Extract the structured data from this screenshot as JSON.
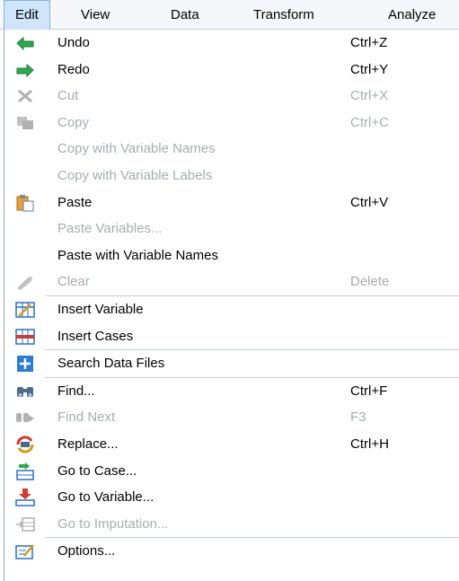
{
  "menubar": {
    "items": [
      {
        "label": "Edit",
        "active": true
      },
      {
        "label": "View",
        "active": false
      },
      {
        "label": "Data",
        "active": false
      },
      {
        "label": "Transform",
        "active": false
      },
      {
        "label": "Analyze",
        "active": false
      }
    ]
  },
  "menu": {
    "items": [
      {
        "label": "Undo",
        "shortcut": "Ctrl+Z",
        "icon": "undo-icon",
        "enabled": true
      },
      {
        "label": "Redo",
        "shortcut": "Ctrl+Y",
        "icon": "redo-icon",
        "enabled": true
      },
      {
        "label": "Cut",
        "shortcut": "Ctrl+X",
        "icon": "cut-icon",
        "enabled": false
      },
      {
        "label": "Copy",
        "shortcut": "Ctrl+C",
        "icon": "copy-icon",
        "enabled": false
      },
      {
        "label": "Copy with Variable Names",
        "shortcut": "",
        "icon": "",
        "enabled": false
      },
      {
        "label": "Copy with Variable Labels",
        "shortcut": "",
        "icon": "",
        "enabled": false
      },
      {
        "label": "Paste",
        "shortcut": "Ctrl+V",
        "icon": "paste-icon",
        "enabled": true
      },
      {
        "label": "Paste Variables...",
        "shortcut": "",
        "icon": "",
        "enabled": false
      },
      {
        "label": "Paste with Variable Names",
        "shortcut": "",
        "icon": "",
        "enabled": true
      },
      {
        "label": "Clear",
        "shortcut": "Delete",
        "icon": "clear-icon",
        "enabled": false
      },
      {
        "label": "Insert Variable",
        "shortcut": "",
        "icon": "insert-variable-icon",
        "enabled": true
      },
      {
        "label": "Insert Cases",
        "shortcut": "",
        "icon": "insert-cases-icon",
        "enabled": true
      },
      {
        "label": "Search Data Files",
        "shortcut": "",
        "icon": "search-data-files-icon",
        "enabled": true
      },
      {
        "label": "Find...",
        "shortcut": "Ctrl+F",
        "icon": "find-icon",
        "enabled": true
      },
      {
        "label": "Find Next",
        "shortcut": "F3",
        "icon": "find-next-icon",
        "enabled": false
      },
      {
        "label": "Replace...",
        "shortcut": "Ctrl+H",
        "icon": "replace-icon",
        "enabled": true
      },
      {
        "label": "Go to Case...",
        "shortcut": "",
        "icon": "go-to-case-icon",
        "enabled": true
      },
      {
        "label": "Go to Variable...",
        "shortcut": "",
        "icon": "go-to-variable-icon",
        "enabled": true
      },
      {
        "label": "Go to Imputation...",
        "shortcut": "",
        "icon": "go-to-imputation-icon",
        "enabled": false
      },
      {
        "label": "Options...",
        "shortcut": "",
        "icon": "options-icon",
        "enabled": true
      }
    ]
  },
  "colors": {
    "menubar_bg": "#f5f7fa",
    "active_menu_bg": "#cfe5fb",
    "disabled_text": "#a7acb3",
    "icon_green": "#2fa84f",
    "icon_blue": "#2a6fc9"
  }
}
